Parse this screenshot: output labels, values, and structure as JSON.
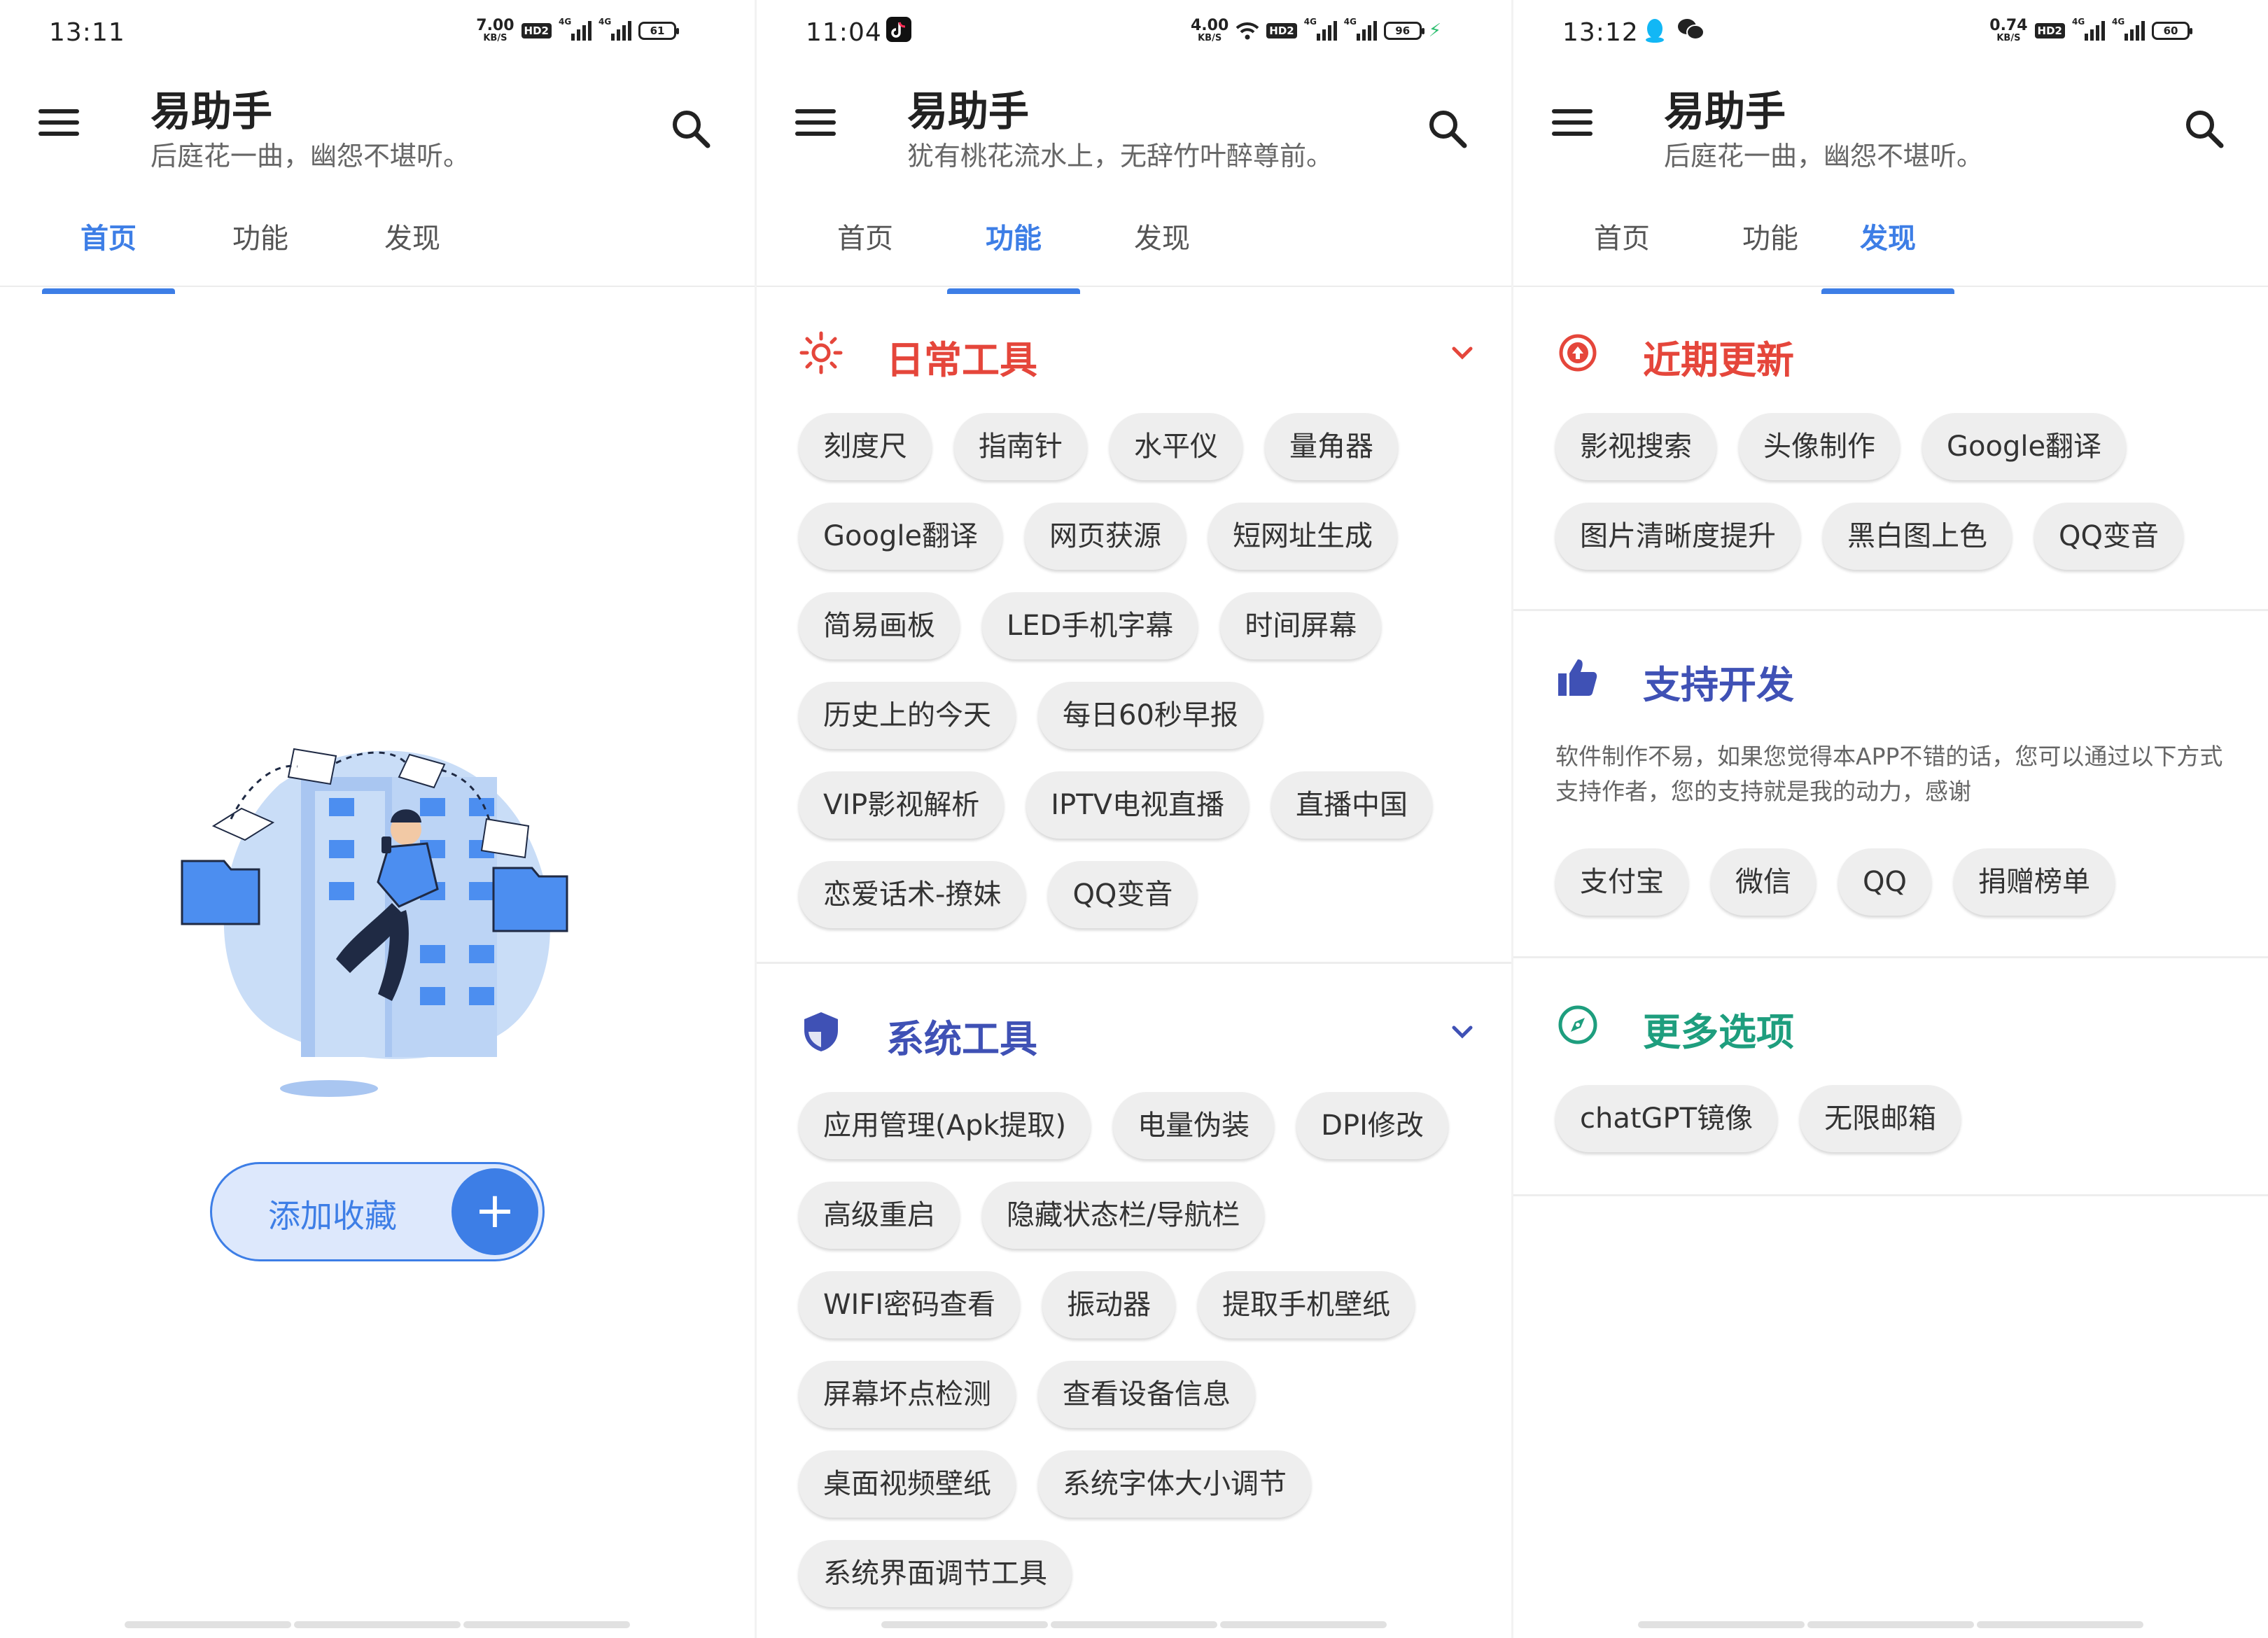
{
  "app": {
    "title": "易助手",
    "search_icon": "search-icon",
    "menu_icon": "menu-icon"
  },
  "accent": "#3d7ee6",
  "screens": [
    {
      "status": {
        "time": "13:11",
        "netspeed": "7.00",
        "netunit": "KB/S",
        "hd": "HD2",
        "sig1": "4G",
        "sig2": "4G",
        "battery": "61"
      },
      "subtitle": "后庭花一曲，幽怨不堪听。",
      "tabs": [
        "首页",
        "功能",
        "发现"
      ],
      "active_tab": 0,
      "fab_label": "添加收藏",
      "fab_icon": "plus-icon",
      "illustration": "person-with-folders-illustration"
    },
    {
      "status": {
        "time": "11:04",
        "netspeed": "4.00",
        "netunit": "KB/S",
        "hd": "HD2",
        "sig1": "4G",
        "sig2": "4G",
        "battery": "96",
        "charging": true,
        "app_icons": [
          "tiktok-icon"
        ]
      },
      "subtitle": "犹有桃花流水上，无辞竹叶醉尊前。",
      "tabs": [
        "首页",
        "功能",
        "发现"
      ],
      "active_tab": 1,
      "sections": [
        {
          "title": "日常工具",
          "color": "#e5463b",
          "icon": "sun-icon",
          "chips": [
            "刻度尺",
            "指南针",
            "水平仪",
            "量角器",
            "Google翻译",
            "网页获源",
            "短网址生成",
            "简易画板",
            "LED手机字幕",
            "时间屏幕",
            "历史上的今天",
            "每日60秒早报",
            "VIP影视解析",
            "IPTV电视直播",
            "直播中国",
            "恋爱话术-撩妹",
            "QQ变音"
          ]
        },
        {
          "title": "系统工具",
          "color": "#3f51b5",
          "icon": "shield-icon",
          "chips": [
            "应用管理(Apk提取)",
            "电量伪装",
            "DPI修改",
            "高级重启",
            "隐藏状态栏/导航栏",
            "WIFI密码查看",
            "振动器",
            "提取手机壁纸",
            "屏幕坏点检测",
            "查看设备信息",
            "桌面视频壁纸",
            "系统字体大小调节",
            "系统界面调节工具"
          ]
        }
      ]
    },
    {
      "status": {
        "time": "13:12",
        "netspeed": "0.74",
        "netunit": "KB/S",
        "hd": "HD2",
        "sig1": "4G",
        "sig2": "4G",
        "battery": "60",
        "app_icons": [
          "qq-icon",
          "wechat-icon"
        ]
      },
      "subtitle": "后庭花一曲，幽怨不堪听。",
      "tabs": [
        "首页",
        "功能",
        "发现"
      ],
      "active_tab": 2,
      "sections": [
        {
          "title": "近期更新",
          "color": "#e5463b",
          "icon": "arrow-up-circle-icon",
          "chips": [
            "影视搜索",
            "头像制作",
            "Google翻译",
            "图片清晰度提升",
            "黑白图上色",
            "QQ变音"
          ]
        },
        {
          "title": "支持开发",
          "color": "#3f51b5",
          "icon": "thumbs-up-icon",
          "desc": "软件制作不易，如果您觉得本APP不错的话，您可以通过以下方式支持作者，您的支持就是我的动力，感谢",
          "chips": [
            "支付宝",
            "微信",
            "QQ",
            "捐赠榜单"
          ]
        },
        {
          "title": "更多选项",
          "color": "#1e9e7e",
          "icon": "compass-icon",
          "chips": [
            "chatGPT镜像",
            "无限邮箱"
          ]
        }
      ]
    }
  ]
}
